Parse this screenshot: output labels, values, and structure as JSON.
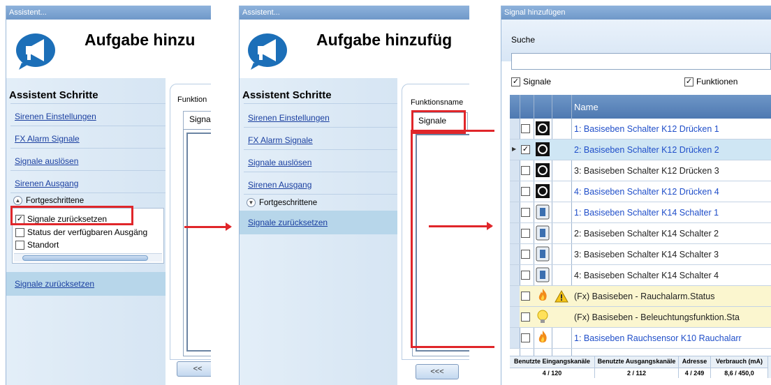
{
  "panel1": {
    "window_title": "Assistent...",
    "header_title": "Aufgabe hinzu",
    "sidebar_title": "Assistent Schritte",
    "links": [
      "Sirenen Einstellungen",
      "FX Alarm Signale",
      "Signale auslösen",
      "Sirenen Ausgang"
    ],
    "advanced_label": "Fortgeschrittene",
    "options": [
      "Signale zurücksetzen",
      "Status der verfügbaren Ausgäng",
      "Standort"
    ],
    "selected_link": "Signale zurücksetzen",
    "func_label": "Funktion",
    "tab_label": "Signa",
    "nav_button": "<<"
  },
  "panel2": {
    "window_title": "Assistent...",
    "header_title": "Aufgabe hinzufüg",
    "sidebar_title": "Assistent Schritte",
    "links": [
      "Sirenen Einstellungen",
      "FX Alarm Signale",
      "Signale auslösen",
      "Sirenen Ausgang"
    ],
    "advanced_label": "Fortgeschrittene",
    "selected_link": "Signale zurücksetzen",
    "func_label": "Funktionsname",
    "tab_label": "Signale",
    "nav_button": "<<<"
  },
  "panel3": {
    "window_title": "Signal hinzufügen",
    "search_label": "Suche",
    "search_value": "",
    "filter_signals": "Signale",
    "filter_functions": "Funktionen",
    "column_name": "Name",
    "rows": [
      {
        "text": "1: Basiseben Schalter K12 Drücken 1",
        "icon": "push-button-icon",
        "checked": false,
        "style": "blue"
      },
      {
        "text": "2: Basiseben Schalter K12 Drücken 2",
        "icon": "push-button-icon",
        "checked": true,
        "style": "blue"
      },
      {
        "text": "3: Basiseben Schalter K12 Drücken 3",
        "icon": "push-button-icon",
        "checked": false,
        "style": "dark"
      },
      {
        "text": "4: Basiseben Schalter K12 Drücken 4",
        "icon": "push-button-icon",
        "checked": false,
        "style": "blue"
      },
      {
        "text": "1: Basiseben Schalter K14 Schalter 1",
        "icon": "switch-icon",
        "checked": false,
        "style": "blue"
      },
      {
        "text": "2: Basiseben Schalter K14 Schalter 2",
        "icon": "switch-icon",
        "checked": false,
        "style": "dark"
      },
      {
        "text": "3: Basiseben Schalter K14 Schalter 3",
        "icon": "switch-icon",
        "checked": false,
        "style": "dark"
      },
      {
        "text": "4: Basiseben Schalter K14 Schalter 4",
        "icon": "switch-icon",
        "checked": false,
        "style": "dark"
      },
      {
        "text": "(Fx) Basiseben - Rauchalarm.Status",
        "icon": "fire-icon",
        "warn": true,
        "checked": false,
        "style": "dark",
        "highlight": true
      },
      {
        "text": "(Fx) Basiseben - Beleuchtungsfunktion.Sta",
        "icon": "bulb-icon",
        "checked": false,
        "style": "dark",
        "highlight": true
      },
      {
        "text": "1: Basiseben Rauchsensor K10 Rauchalarr",
        "icon": "fire-icon",
        "checked": false,
        "style": "blue"
      }
    ],
    "status": {
      "in_label": "Benutzte Eingangskanäle",
      "out_label": "Benutzte Ausgangskanäle",
      "addr_label": "Adresse",
      "cons_label": "Verbrauch (mA)",
      "in_value": "4 / 120",
      "out_value": "2 / 112",
      "addr_value": "4 / 249",
      "cons_value": "8,6 / 450,0"
    }
  },
  "colors": {
    "accent_red": "#e0262a",
    "link_blue": "#1a3fa0",
    "selected_row": "#b7d6ea"
  }
}
